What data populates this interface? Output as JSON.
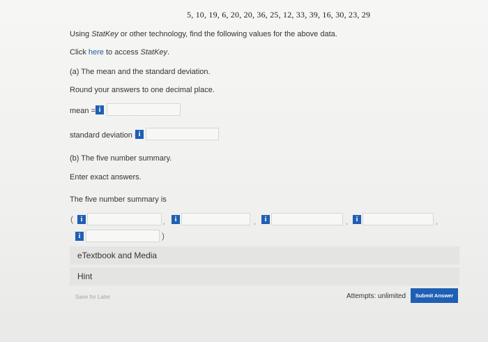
{
  "question": {
    "dataset": "5, 10, 19, 6, 20, 20, 36, 25, 12, 33, 39, 16, 30, 23, 29",
    "intro_prefix": "Using ",
    "intro_statkey": "StatKey",
    "intro_suffix": " or other technology, find the following values for the above data.",
    "click_prefix": "Click ",
    "click_link": "here",
    "click_mid": " to access ",
    "click_statkey": "StatKey",
    "click_end": ".",
    "part_a": "(a) The mean and the standard deviation.",
    "round_note": "Round your answers to one decimal place.",
    "mean_label": "mean =",
    "sd_label": "standard deviation =",
    "part_b": "(b) The five number summary.",
    "exact_note": "Enter exact answers.",
    "five_label": "The five number summary is",
    "open_paren": "(",
    "close_paren": ")",
    "comma": ","
  },
  "info_icon": {
    "glyph": "i",
    "color": "#1f5fb4"
  },
  "inputs": {
    "mean": "",
    "sd": "",
    "five": [
      "",
      "",
      "",
      "",
      ""
    ]
  },
  "panels": {
    "etextbook": "eTextbook and Media",
    "hint": "Hint"
  },
  "footer": {
    "save_label": "Save for Later",
    "attempts": "Attempts: unlimited",
    "submit_label": "Submit Answer"
  }
}
